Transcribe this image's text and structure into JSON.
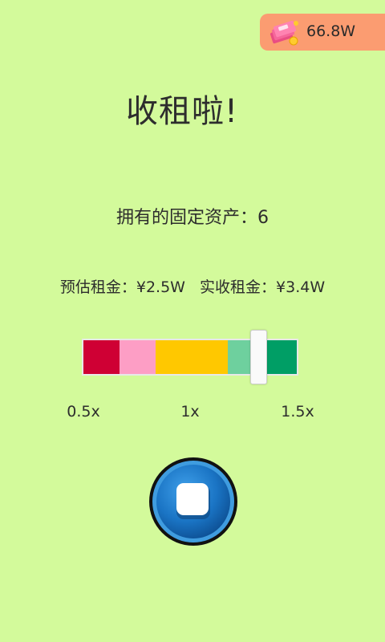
{
  "header": {
    "money": "66.8W",
    "money_icon": "cash-stack-icon"
  },
  "title": "收租啦!",
  "assets": {
    "label": "拥有的固定资产：",
    "count": "6"
  },
  "rent": {
    "estimated_label": "预估租金：",
    "estimated_value": "¥2.5W",
    "actual_label": "实收租金：",
    "actual_value": "¥3.4W"
  },
  "multiplier_bar": {
    "segment_colors": [
      "#cf0034",
      "#fd9ec5",
      "#ffc800",
      "#6ed09e",
      "#009e65"
    ],
    "ticks": [
      "0.5x",
      "1x",
      "1.5x"
    ],
    "slider_value": "1.4"
  },
  "controls": {
    "stop_button_icon": "stop-icon",
    "button_color": "#1a74c4"
  }
}
